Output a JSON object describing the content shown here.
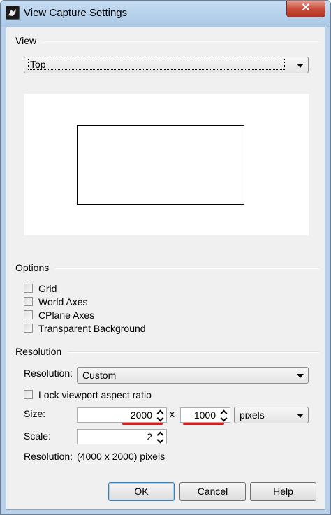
{
  "window": {
    "title": "View Capture Settings",
    "close_glyph": "✕",
    "icon": "rhino-app-icon"
  },
  "view_group": {
    "label": "View",
    "selected": "Top"
  },
  "options_group": {
    "label": "Options",
    "checkboxes": [
      {
        "label": "Grid",
        "checked": false
      },
      {
        "label": "World Axes",
        "checked": false
      },
      {
        "label": "CPlane Axes",
        "checked": false
      },
      {
        "label": "Transparent Background",
        "checked": false
      }
    ]
  },
  "resolution_group": {
    "label": "Resolution",
    "resolution_label": "Resolution:",
    "resolution_selected": "Custom",
    "lock_label": "Lock viewport aspect ratio",
    "lock_checked": false,
    "size_label": "Size:",
    "width": "2000",
    "separator": "x",
    "height": "1000",
    "units": "pixels",
    "scale_label": "Scale:",
    "scale": "2",
    "summary_label": "Resolution:",
    "summary_value": "(4000 x 2000) pixels"
  },
  "buttons": {
    "ok": "OK",
    "cancel": "Cancel",
    "help": "Help"
  },
  "annotation_color": "#e01b1b"
}
